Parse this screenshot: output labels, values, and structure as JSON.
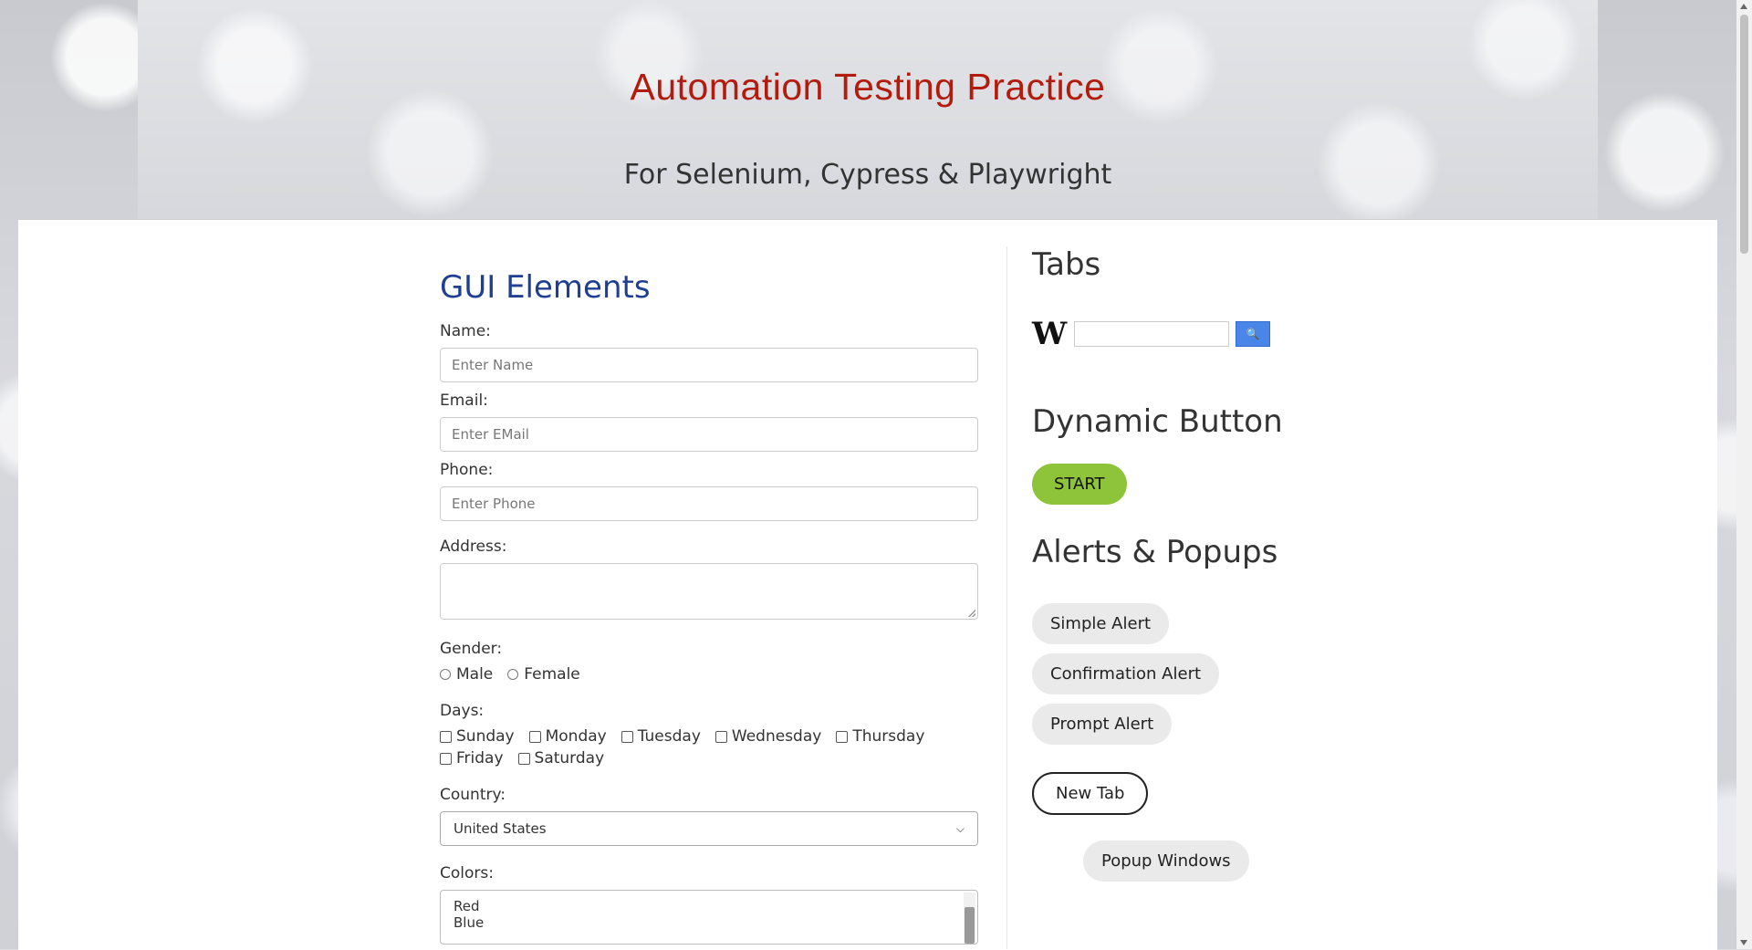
{
  "header": {
    "title": "Automation Testing Practice",
    "subtitle": "For Selenium, Cypress & Playwright"
  },
  "gui": {
    "title": "GUI Elements",
    "name": {
      "label": "Name:",
      "placeholder": "Enter Name"
    },
    "email": {
      "label": "Email:",
      "placeholder": "Enter EMail"
    },
    "phone": {
      "label": "Phone:",
      "placeholder": "Enter Phone"
    },
    "address": {
      "label": "Address:"
    },
    "gender": {
      "label": "Gender:",
      "options": [
        "Male",
        "Female"
      ]
    },
    "days": {
      "label": "Days:",
      "options": [
        "Sunday",
        "Monday",
        "Tuesday",
        "Wednesday",
        "Thursday",
        "Friday",
        "Saturday"
      ]
    },
    "country": {
      "label": "Country:",
      "selected": "United States"
    },
    "colors": {
      "label": "Colors:",
      "options": [
        "Red",
        "Blue"
      ]
    }
  },
  "right": {
    "tabs_title": "Tabs",
    "wiki": {
      "logo": "W",
      "search_button": "🔍"
    },
    "dynamic_title": "Dynamic Button",
    "start_label": "START",
    "alerts_title": "Alerts & Popups",
    "simple_alert": "Simple Alert",
    "confirm_alert": "Confirmation Alert",
    "prompt_alert": "Prompt Alert",
    "new_tab": "New Tab",
    "popup_windows": "Popup Windows"
  },
  "colors": {
    "title": "#b31b0d",
    "section_title": "#1f3f93",
    "start_button": "#8ec43a",
    "wiki_button": "#4a85e8"
  }
}
